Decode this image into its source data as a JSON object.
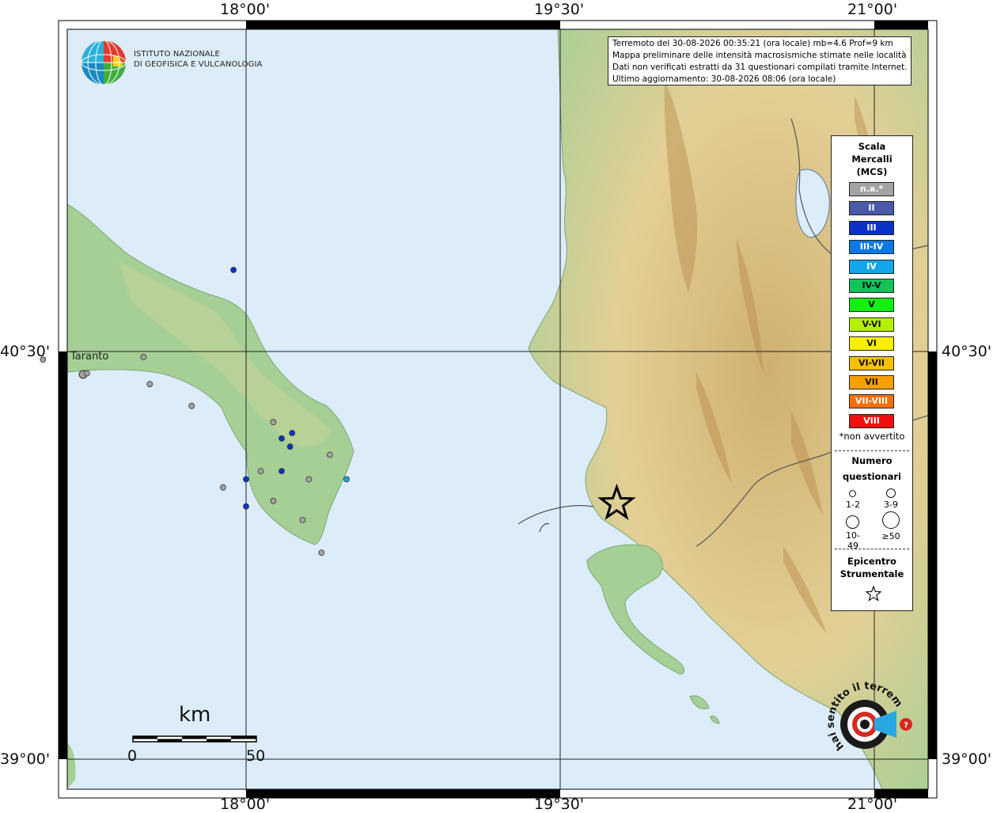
{
  "axis_labels": {
    "top": [
      "18°00'",
      "19°30'",
      "21°00'"
    ],
    "bottom": [
      "18°00'",
      "19°30'",
      "21°00'"
    ],
    "left": [
      "40°30'",
      "39°00'"
    ],
    "right": [
      "40°30'",
      "39°00'"
    ]
  },
  "institute": {
    "line1": "ISTITUTO NAZIONALE",
    "line2": "DI GEOFISICA E VULCANOLOGIA"
  },
  "info": {
    "line1": "Terremoto del 30-08-2026 00:35:21 (ora locale) mb=4.6 Prof=9 km",
    "line2": "Mappa preliminare delle intensità macrosismiche stimate nelle località",
    "line3": "Dati non verificati estratti da 31 questionari compilati tramite Internet.",
    "line4": "Ultimo aggiornamento: 30-08-2026 08:06 (ora locale)"
  },
  "legend": {
    "title_line1": "Scala",
    "title_line2": "Mercalli",
    "title_line3": "(MCS)",
    "scale": [
      {
        "label": "n.a.*",
        "color": "#a3a3a3",
        "text_color": "#ffffff"
      },
      {
        "label": "II",
        "color": "#4a5aa8",
        "text_color": "#ffffff"
      },
      {
        "label": "III",
        "color": "#0a32c8",
        "text_color": "#ffffff"
      },
      {
        "label": "III-IV",
        "color": "#0a78e6",
        "text_color": "#ffffff"
      },
      {
        "label": "IV",
        "color": "#12a6ea",
        "text_color": "#ffffff"
      },
      {
        "label": "IV-V",
        "color": "#12c25a",
        "text_color": "#111111"
      },
      {
        "label": "V",
        "color": "#12f012",
        "text_color": "#111111"
      },
      {
        "label": "V-VI",
        "color": "#b4f000",
        "text_color": "#111111"
      },
      {
        "label": "VI",
        "color": "#f8f000",
        "text_color": "#111111"
      },
      {
        "label": "VI-VII",
        "color": "#f8c000",
        "text_color": "#111111"
      },
      {
        "label": "VII",
        "color": "#f8a000",
        "text_color": "#111111"
      },
      {
        "label": "VII-VIII",
        "color": "#f86e00",
        "text_color": "#ffffff"
      },
      {
        "label": "VIII",
        "color": "#f01010",
        "text_color": "#ffffff"
      }
    ],
    "not_felt_note": "*non avvertito",
    "questionnaires_line1": "Numero",
    "questionnaires_line2": "questionari",
    "sizes": [
      "1-2",
      "3-9",
      "10-49",
      "≥50"
    ],
    "epicenter_line1": "Epicentro",
    "epicenter_line2": "Strumentale"
  },
  "places": [
    {
      "name": "Taranto"
    }
  ],
  "scale_bar": {
    "unit": "km",
    "start": "0",
    "end": "50"
  },
  "observations": [
    {
      "lon": 17.24,
      "lat": 40.42,
      "intensity": "n.a.*"
    },
    {
      "lon": 17.51,
      "lat": 40.48,
      "intensity": "n.a.*"
    },
    {
      "lon": 17.54,
      "lat": 40.38,
      "intensity": "n.a.*"
    },
    {
      "lon": 17.74,
      "lat": 40.3,
      "intensity": "n.a.*"
    },
    {
      "lon": 17.89,
      "lat": 40.0,
      "intensity": "n.a.*"
    },
    {
      "lon": 18.07,
      "lat": 40.06,
      "intensity": "n.a.*"
    },
    {
      "lon": 18.13,
      "lat": 40.24,
      "intensity": "n.a.*"
    },
    {
      "lon": 18.13,
      "lat": 39.95,
      "intensity": "n.a.*"
    },
    {
      "lon": 18.27,
      "lat": 39.88,
      "intensity": "n.a.*"
    },
    {
      "lon": 18.3,
      "lat": 40.03,
      "intensity": "n.a.*"
    },
    {
      "lon": 18.36,
      "lat": 39.76,
      "intensity": "n.a.*"
    },
    {
      "lon": 18.4,
      "lat": 40.12,
      "intensity": "n.a.*"
    },
    {
      "lon": 17.03,
      "lat": 40.47,
      "intensity": "n.a.*"
    },
    {
      "lon": 17.94,
      "lat": 40.8,
      "intensity": "III"
    },
    {
      "lon": 18.17,
      "lat": 40.18,
      "intensity": "III"
    },
    {
      "lon": 18.21,
      "lat": 40.15,
      "intensity": "III"
    },
    {
      "lon": 18.22,
      "lat": 40.2,
      "intensity": "III"
    },
    {
      "lon": 18.17,
      "lat": 40.06,
      "intensity": "III"
    },
    {
      "lon": 18.0,
      "lat": 40.03,
      "intensity": "III"
    },
    {
      "lon": 18.0,
      "lat": 39.93,
      "intensity": "III"
    },
    {
      "lon": 18.48,
      "lat": 40.03,
      "intensity": "IV"
    }
  ],
  "epicenter": {
    "lon": 19.77,
    "lat": 39.94
  },
  "colors": {
    "sea": "#dcecf8",
    "land_low": "#9ccb92",
    "land_mid": "#e8d49a",
    "land_high": "#c69a58",
    "frame": "#000000"
  }
}
